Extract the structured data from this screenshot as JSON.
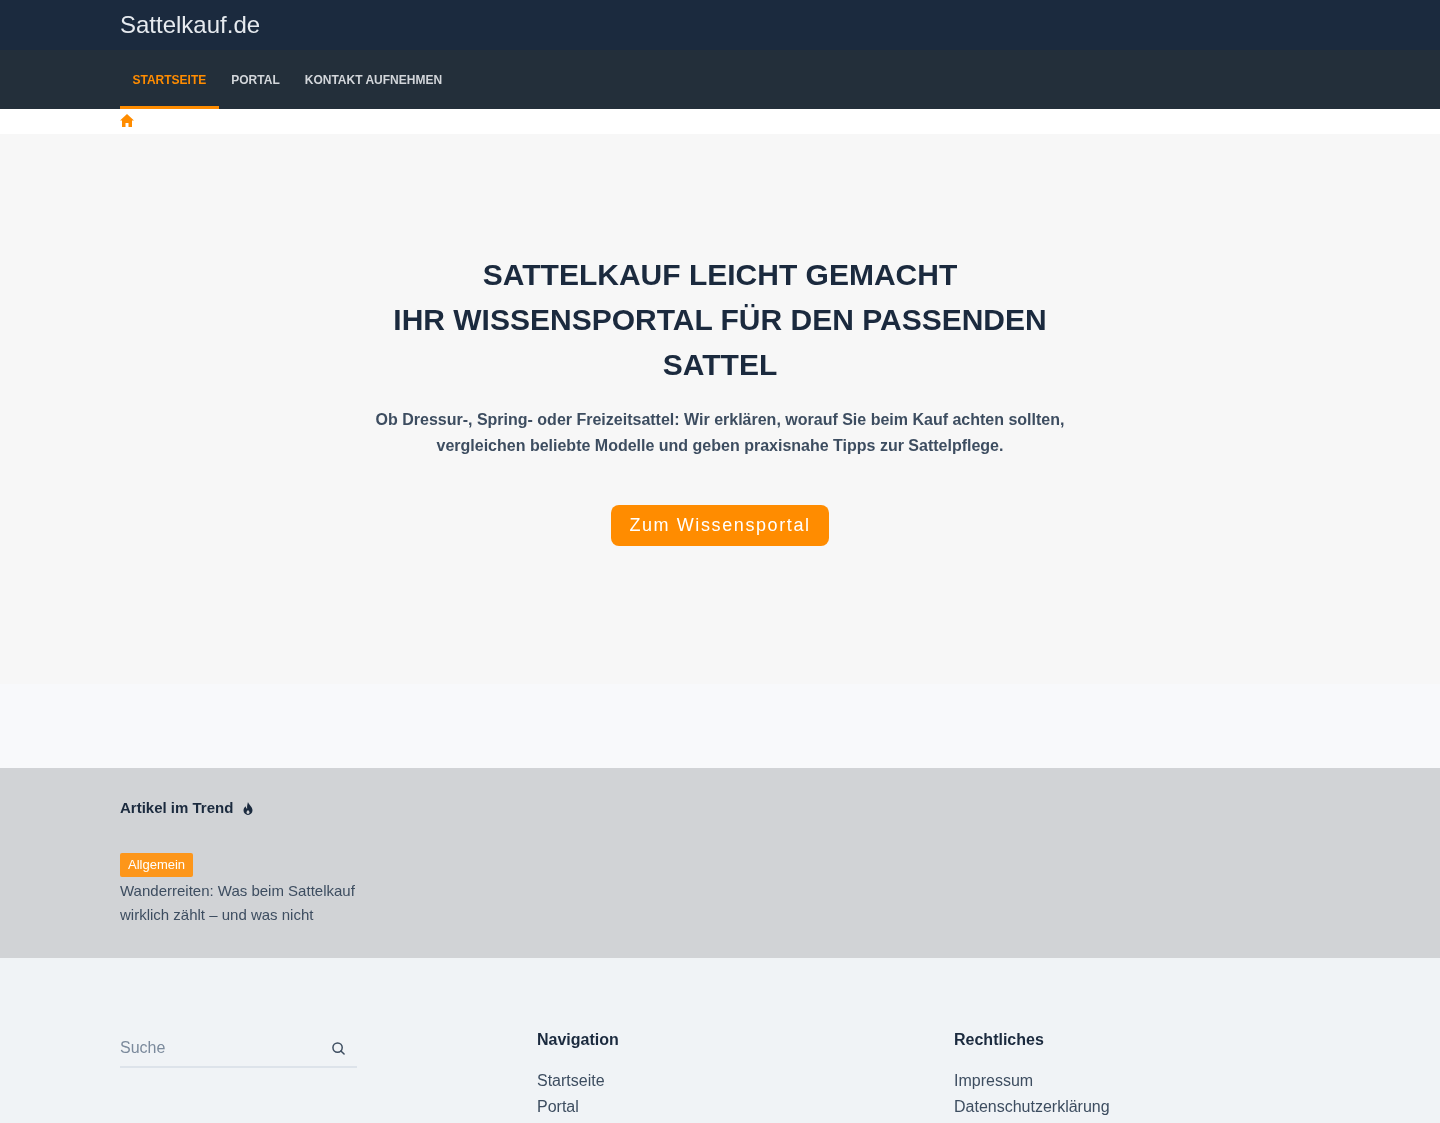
{
  "header": {
    "site_title": "Sattelkauf.de"
  },
  "nav": {
    "items": [
      {
        "label": "STARTSEITE",
        "selected": true
      },
      {
        "label": "PORTAL",
        "selected": false
      },
      {
        "label": "KONTAKT AUFNEHMEN",
        "selected": false
      }
    ]
  },
  "hero": {
    "title_lines": [
      "SATTELKAUF LEICHT GEMACHT",
      "IHR WISSENSPORTAL FÜR DEN PASSENDEN SATTEL"
    ],
    "subtitle": "Ob Dressur-, Spring- oder Freizeitsattel: Wir erklären, worauf Sie beim Kauf achten sollten, vergleichen beliebte Modelle und geben praxisnahe Tipps zur Sattelpflege.",
    "button": "Zum Wissensportal"
  },
  "trending": {
    "heading": "Artikel im Trend",
    "articles": [
      {
        "category": "Allgemein",
        "title": "Wanderreiten: Was beim Sattelkauf wirklich zählt – und was nicht"
      }
    ]
  },
  "footer": {
    "search": {
      "placeholder": "Suche"
    },
    "columns": [
      {
        "heading": "Navigation",
        "links": [
          "Startseite",
          "Portal"
        ]
      },
      {
        "heading": "Rechtliches",
        "links": [
          "Impressum",
          "Datenschutzerklärung"
        ]
      }
    ]
  }
}
